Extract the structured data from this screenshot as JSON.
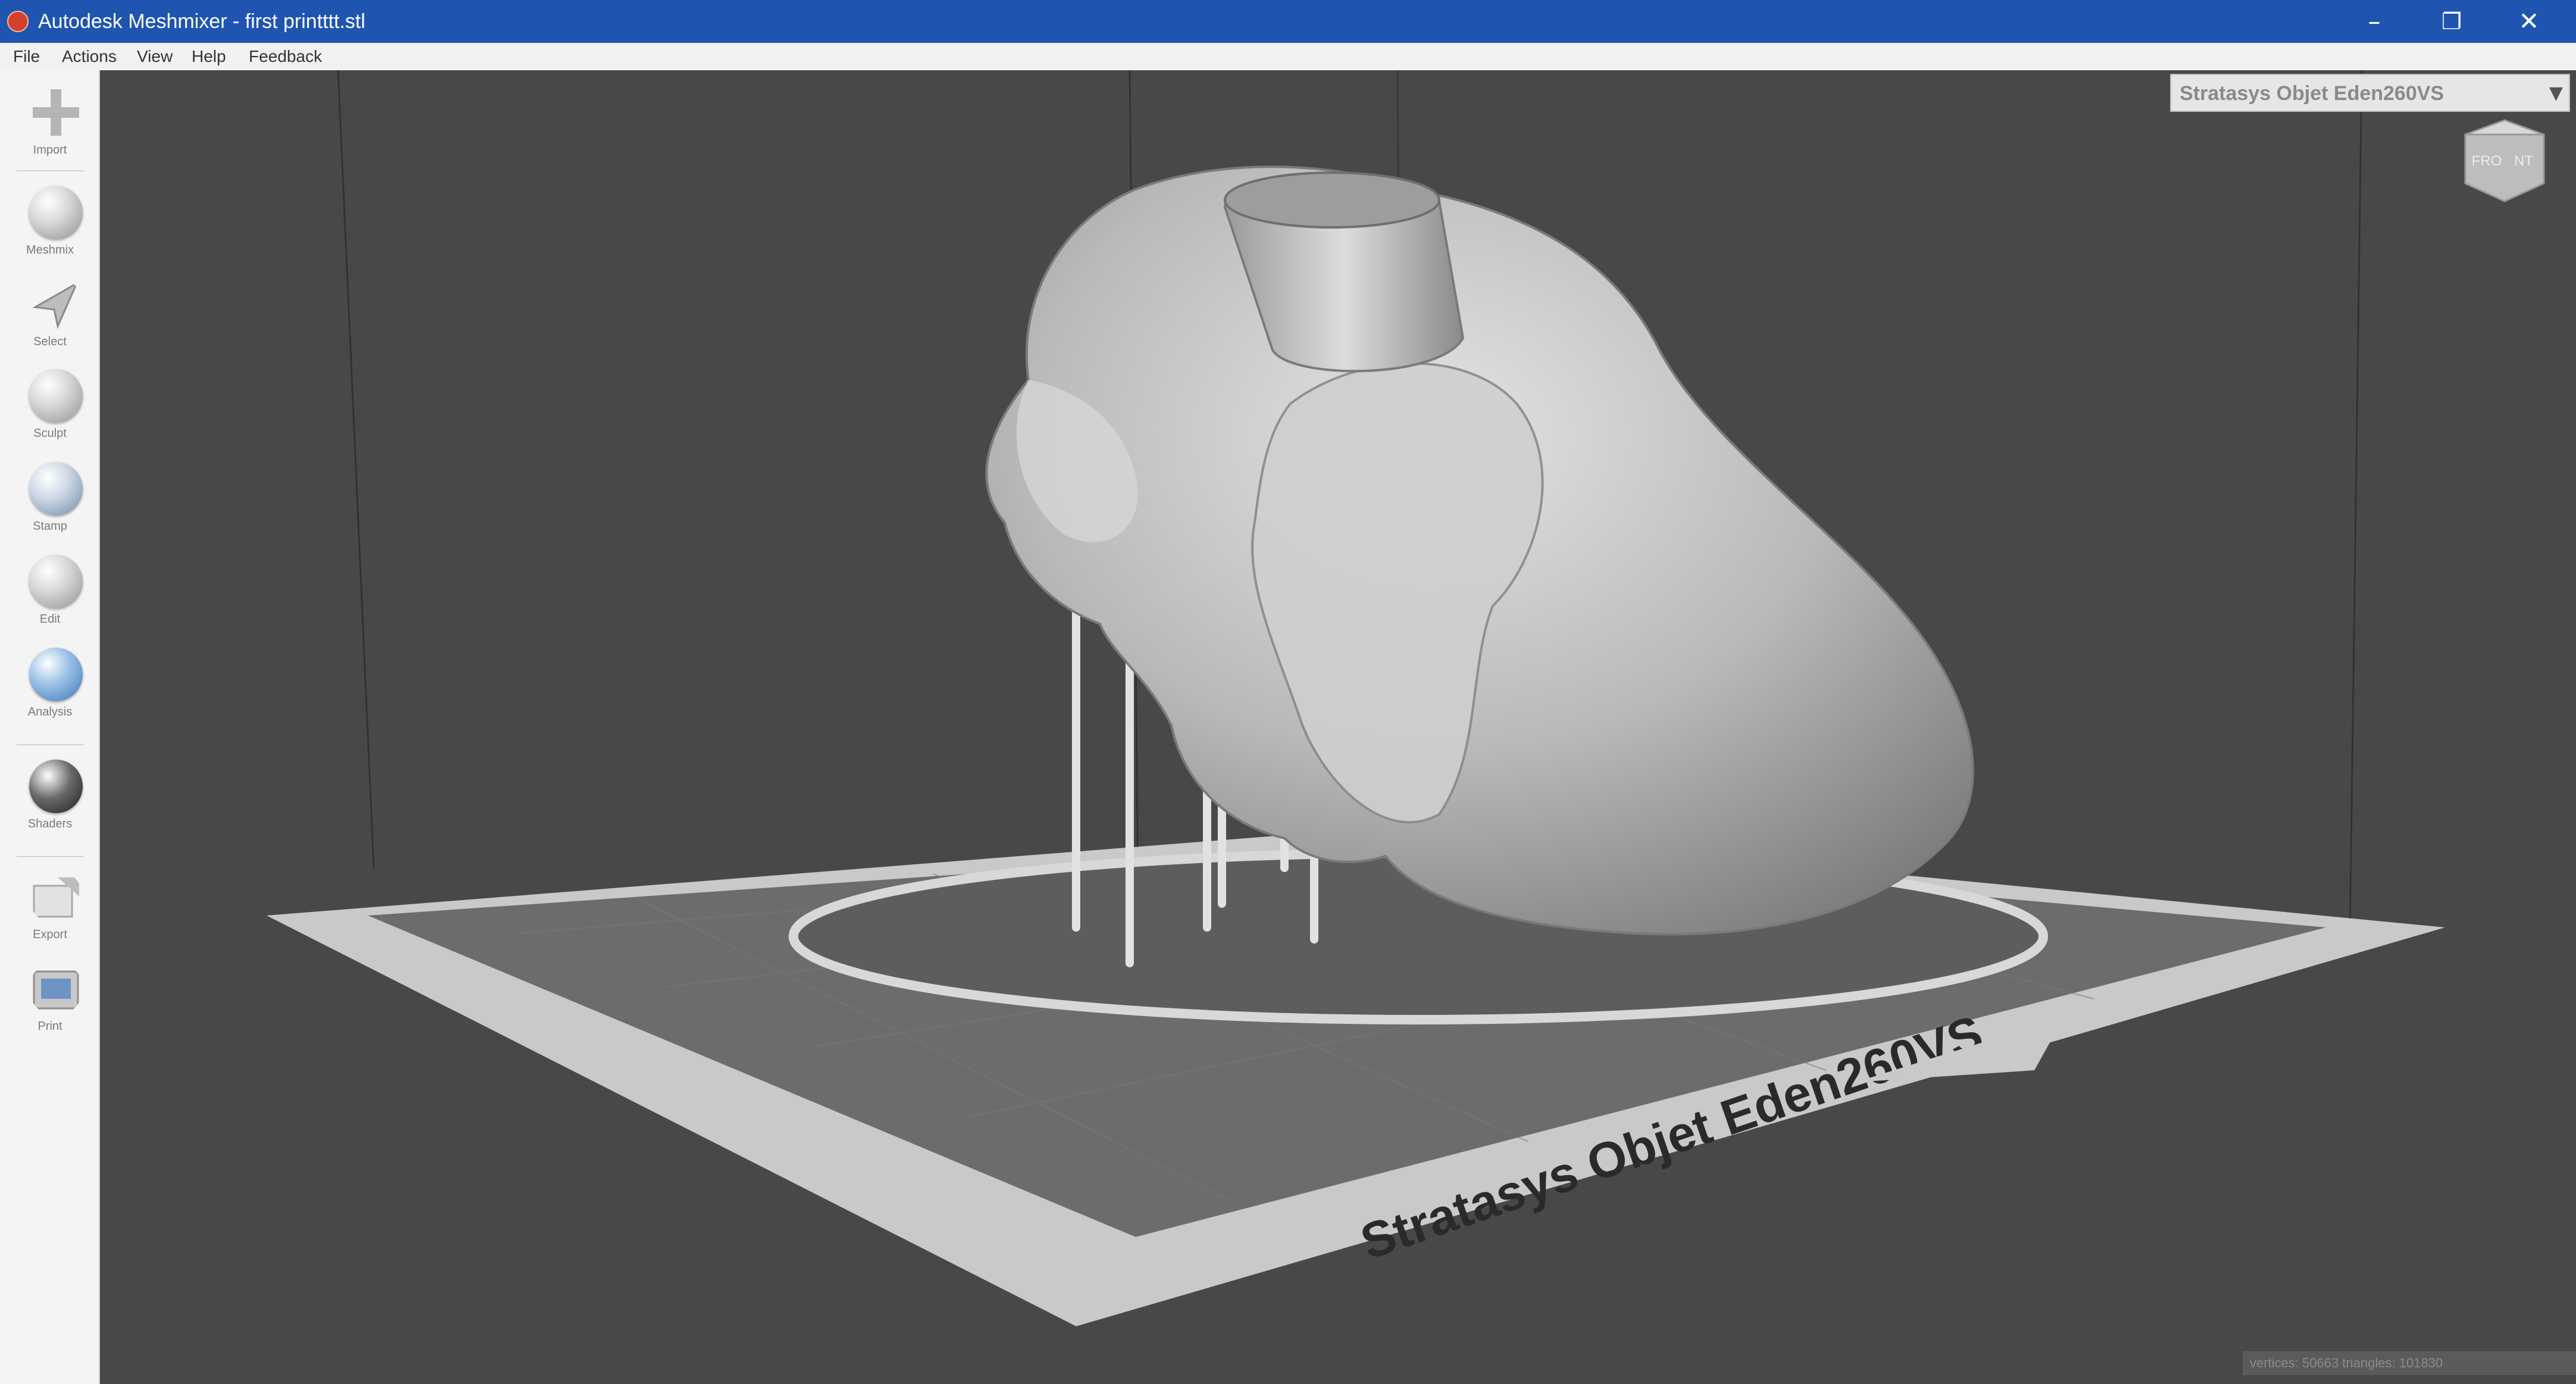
{
  "window": {
    "title": "Autodesk Meshmixer - first printttt.stl",
    "minimize": "–",
    "restore": "❐",
    "close": "✕"
  },
  "menu": {
    "items": [
      "File",
      "Actions",
      "View",
      "Help",
      "Feedback"
    ]
  },
  "toolbar": {
    "tools": [
      {
        "label": "Import",
        "icon": "plus-icon"
      },
      {
        "label": "Meshmix",
        "icon": "meshmix-icon"
      },
      {
        "label": "Select",
        "icon": "select-arrow-icon"
      },
      {
        "label": "Sculpt",
        "icon": "sculpt-brush-icon"
      },
      {
        "label": "Stamp",
        "icon": "stamp-icon"
      },
      {
        "label": "Edit",
        "icon": "edit-icon"
      },
      {
        "label": "Analysis",
        "icon": "analysis-icon"
      },
      {
        "label": "Shaders",
        "icon": "shaders-icon"
      },
      {
        "label": "Export",
        "icon": "export-icon"
      },
      {
        "label": "Print",
        "icon": "print-icon"
      }
    ]
  },
  "viewport": {
    "printer_dropdown": "Stratasys Objet Eden260VS",
    "dropdown_arrow": "▼",
    "bed_label": "Stratasys Objet Eden260VS",
    "nav_cube_labels": [
      "FRO",
      "NT"
    ],
    "status": "vertices: 50663  triangles: 101830"
  },
  "colors": {
    "titlebar": "#1f55b0",
    "viewport_bg": "#4a4847",
    "bed_border": "#c9c9c9",
    "bed_plate": "#6e6c6b",
    "model": "#bcbcbc"
  }
}
